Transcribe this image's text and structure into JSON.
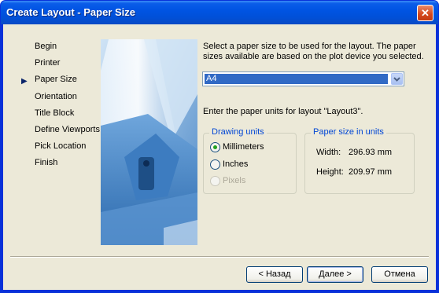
{
  "window": {
    "title": "Create Layout - Paper Size",
    "close_glyph": "✕"
  },
  "nav": {
    "items": [
      {
        "label": "Begin"
      },
      {
        "label": "Printer"
      },
      {
        "label": "Paper Size"
      },
      {
        "label": "Orientation"
      },
      {
        "label": "Title Block"
      },
      {
        "label": "Define Viewports"
      },
      {
        "label": "Pick Location"
      },
      {
        "label": "Finish"
      }
    ],
    "current": "Paper Size",
    "pointer_glyph": "▶"
  },
  "main": {
    "instruction_lines": [
      "Select a paper size to be used for the layout.  The paper",
      "sizes available are based on the plot device you selected."
    ],
    "paper_size": {
      "value": "A4"
    },
    "units_instruction": "Enter the paper units for layout \"Layout3\"."
  },
  "drawing_units": {
    "title": "Drawing units",
    "options": [
      {
        "label": "Millimeters",
        "checked": true,
        "enabled": true
      },
      {
        "label": "Inches",
        "checked": false,
        "enabled": true
      },
      {
        "label": "Pixels",
        "checked": false,
        "enabled": false
      }
    ]
  },
  "paper_size_units": {
    "title": "Paper size in units",
    "width_label": "Width:",
    "width_value": "296.93 mm",
    "height_label": "Height:",
    "height_value": "209.97 mm"
  },
  "buttons": {
    "back": "< Назад",
    "next": "Далее >",
    "cancel": "Отмена"
  },
  "colors": {
    "title_bar": "#0054e3",
    "dialog_bg": "#ece9d8",
    "selection": "#316ac5",
    "group_title": "#0046d5",
    "radio_dot": "#21a121"
  }
}
